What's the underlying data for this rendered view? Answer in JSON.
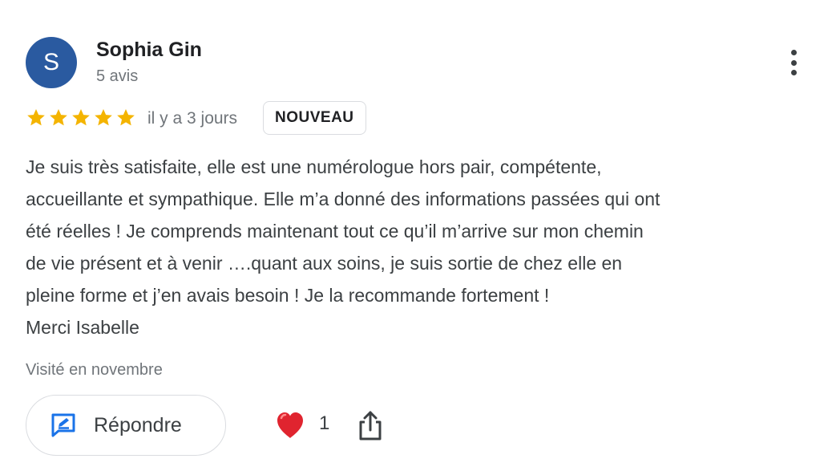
{
  "reviewer": {
    "initial": "S",
    "name": "Sophia Gin",
    "review_count": "5 avis",
    "avatar_color": "#2a5aa0"
  },
  "menu_icon": "more-vertical-icon",
  "rating": {
    "stars": 5,
    "max": 5,
    "star_color": "#f4b400"
  },
  "date": "il y a 3 jours",
  "badge": "NOUVEAU",
  "review_lines": [
    "Je suis très satisfaite, elle est une numérologue hors pair, compétente,",
    "accueillante et sympathique. Elle m’a donné des informations passées qui ont",
    "été réelles ! Je comprends maintenant tout ce qu’il m’arrive sur mon chemin",
    "de vie présent et à venir ….quant aux soins, je suis sortie de chez elle en",
    "pleine forme et j’en avais besoin ! Je la recommande fortement !",
    "Merci Isabelle"
  ],
  "visited": "Visité en novembre",
  "actions": {
    "reply_label": "Répondre",
    "reply_icon": "reply-edit-icon",
    "like_icon": "heart-icon",
    "like_count": "1",
    "share_icon": "share-icon",
    "accent_color": "#1a73e8",
    "heart_color": "#e0242f"
  }
}
